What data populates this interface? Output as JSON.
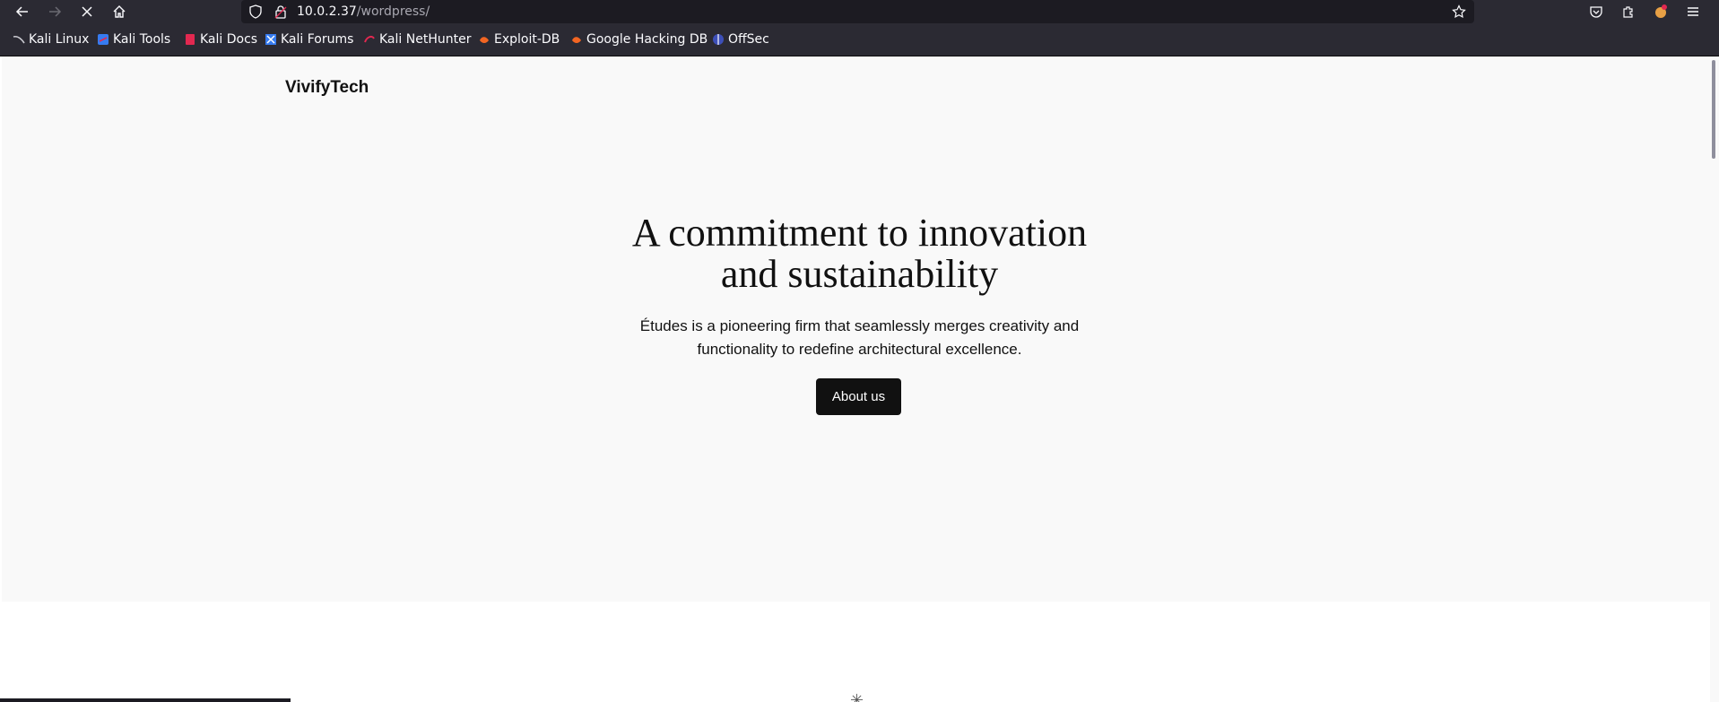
{
  "browser": {
    "url_host": "10.0.2.37",
    "url_path": "/wordpress/",
    "nav": {
      "back": "back-arrow-icon",
      "forward": "forward-arrow-icon",
      "stop": "stop-icon",
      "home": "home-icon"
    },
    "bookmarks": [
      {
        "label": "Kali Linux",
        "icon": "kali-icon"
      },
      {
        "label": "Kali Tools",
        "icon": "kali-tools-icon"
      },
      {
        "label": "Kali Docs",
        "icon": "kali-docs-icon"
      },
      {
        "label": "Kali Forums",
        "icon": "kali-forums-icon"
      },
      {
        "label": "Kali NetHunter",
        "icon": "nethunter-icon"
      },
      {
        "label": "Exploit-DB",
        "icon": "exploitdb-icon"
      },
      {
        "label": "Google Hacking DB",
        "icon": "ghdb-icon"
      },
      {
        "label": "OffSec",
        "icon": "offsec-icon"
      }
    ]
  },
  "page": {
    "site_title": "VivifyTech",
    "headline_line1": "A commitment to innovation",
    "headline_line2": "and sustainability",
    "subtitle_line1": "Études is a pioneering firm that seamlessly merges creativity and",
    "subtitle_line2": "functionality to redefine architectural excellence.",
    "cta_label": "About us"
  },
  "colors": {
    "chrome_bg": "#2b2a33",
    "urlbar_bg": "#1c1b22",
    "hero_bg": "#f9f9f9",
    "text": "#111111",
    "button_bg": "#111111"
  }
}
